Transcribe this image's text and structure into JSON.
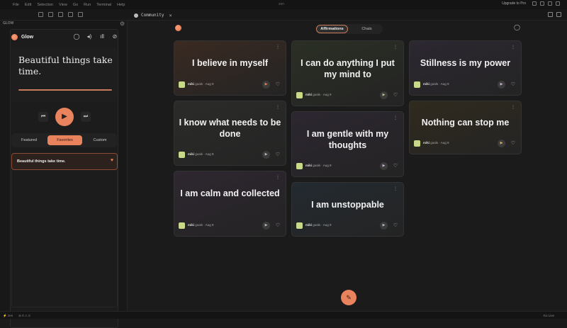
{
  "titlebar": {
    "menu": [
      "File",
      "Edit",
      "Selection",
      "View",
      "Go",
      "Run",
      "Terminal",
      "Help"
    ],
    "center": "zen",
    "upgrade": "Upgrade to Pro"
  },
  "tab": {
    "label": "Community"
  },
  "sidebar": {
    "header": "GLOW",
    "app_name": "Glow",
    "player_quote": "Beautiful things take time.",
    "segments": [
      "Featured",
      "Favorites",
      "Custom"
    ],
    "active_segment": "Favorites",
    "favorite_item": "Beautiful things take time."
  },
  "main": {
    "segments": [
      "Affirmations",
      "Chats"
    ],
    "active_segment": "Affirmations",
    "cards": [
      {
        "text": "I believe in myself",
        "author": "miki",
        "meta": "goals · Aug 9",
        "tint": "#3a2a22",
        "play_color": "#e8835e"
      },
      {
        "text": "I know what needs to be done",
        "author": "miki",
        "meta": "goals · Aug 9",
        "tint": "#2b2b29",
        "play_color": "#bbbbbb"
      },
      {
        "text": "I am calm and collected",
        "author": "miki",
        "meta": "goals · Aug 9",
        "tint": "#2e2630",
        "play_color": "#bbbbbb"
      },
      {
        "text": "I can do anything I put my mind to",
        "author": "miki",
        "meta": "goals · Aug 9",
        "tint": "#2a2f24",
        "play_color": "#b5c48a"
      },
      {
        "text": "I am gentle with my thoughts",
        "author": "miki",
        "meta": "goals · Aug 9",
        "tint": "#2c2630",
        "play_color": "#c8b4d0"
      },
      {
        "text": "I am unstoppable",
        "author": "miki",
        "meta": "goals · Aug 9",
        "tint": "#232a30",
        "play_color": "#bbbbbb"
      },
      {
        "text": "Stillness is my power",
        "author": "miki",
        "meta": "goals · Aug 9",
        "tint": "#2c2731",
        "play_color": "#c8b4d0"
      },
      {
        "text": "Nothing can stop me",
        "author": "miki",
        "meta": "goals · Aug 9",
        "tint": "#302a1e",
        "play_color": "#d9b36a"
      }
    ]
  },
  "statusbar": {
    "left": [
      "⚡ zen",
      "⊘ 0  ⚠ 0"
    ],
    "right": [
      "Go Live"
    ]
  },
  "colors": {
    "accent": "#e8835e"
  }
}
